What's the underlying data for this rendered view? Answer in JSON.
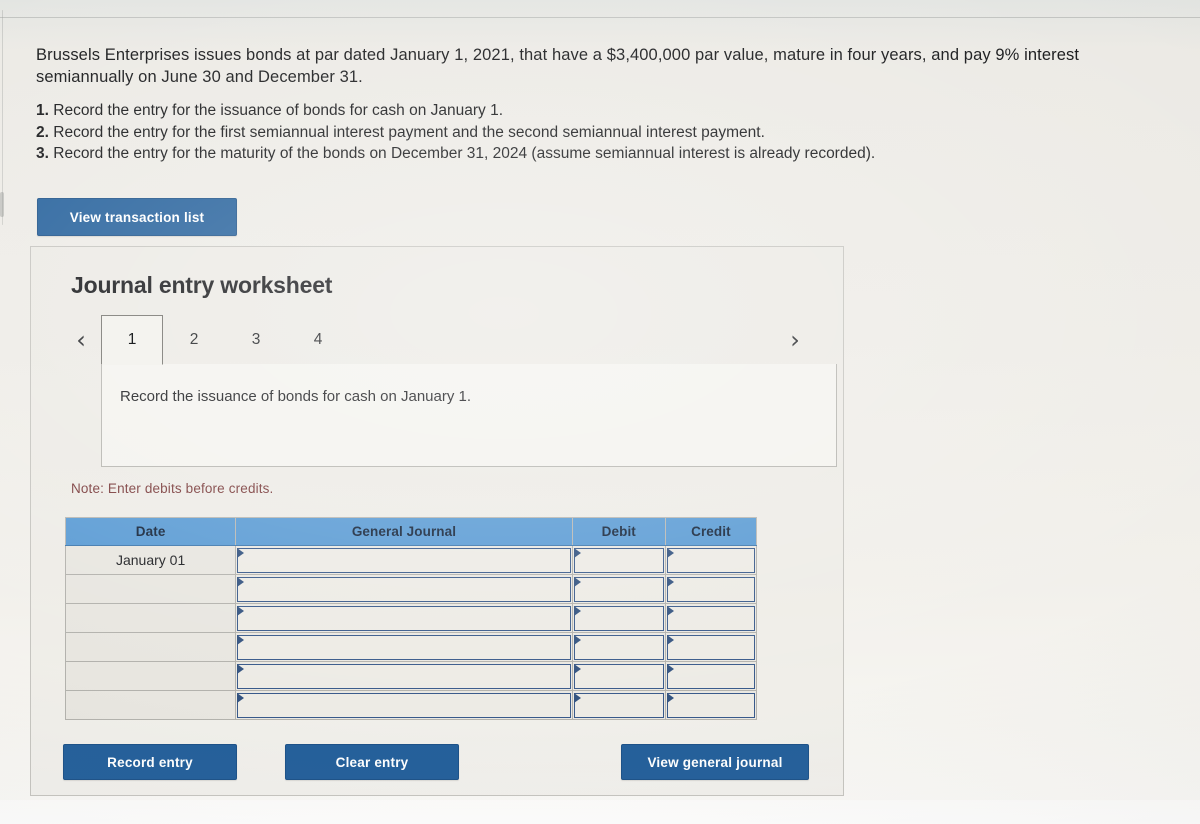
{
  "problem": {
    "statement": "Brussels Enterprises issues bonds at par dated January 1, 2021, that have a $3,400,000 par value, mature in four years, and pay 9% interest semiannually on June 30 and December 31.",
    "requirements": [
      {
        "num": "1.",
        "text": "Record the entry for the issuance of bonds for cash on January 1."
      },
      {
        "num": "2.",
        "text": "Record the entry for the first semiannual interest payment and the second semiannual interest payment."
      },
      {
        "num": "3.",
        "text": "Record the entry for the maturity of the bonds on December 31, 2024 (assume semiannual interest is already recorded)."
      }
    ]
  },
  "toolbar": {
    "view_transaction_list_label": "View transaction list"
  },
  "worksheet": {
    "title": "Journal entry worksheet",
    "prev_icon": "chevron-left-icon",
    "next_icon": "chevron-right-icon",
    "tabs": [
      {
        "label": "1",
        "active": true
      },
      {
        "label": "2",
        "active": false
      },
      {
        "label": "3",
        "active": false
      },
      {
        "label": "4",
        "active": false
      }
    ],
    "prompt": "Record the issuance of bonds for cash on January 1.",
    "note": "Note: Enter debits before credits.",
    "table": {
      "columns": [
        "Date",
        "General Journal",
        "Debit",
        "Credit"
      ],
      "rows": [
        {
          "date": "January 01",
          "general_journal": "",
          "debit": "",
          "credit": ""
        },
        {
          "date": "",
          "general_journal": "",
          "debit": "",
          "credit": ""
        },
        {
          "date": "",
          "general_journal": "",
          "debit": "",
          "credit": ""
        },
        {
          "date": "",
          "general_journal": "",
          "debit": "",
          "credit": ""
        },
        {
          "date": "",
          "general_journal": "",
          "debit": "",
          "credit": ""
        },
        {
          "date": "",
          "general_journal": "",
          "debit": "",
          "credit": ""
        }
      ]
    },
    "buttons": {
      "record_entry_label": "Record entry",
      "clear_entry_label": "Clear entry",
      "view_general_journal_label": "View general journal"
    }
  },
  "colors": {
    "button_blue": "#24609b",
    "table_header_blue": "#5a9bd4",
    "input_border_blue": "#38598a",
    "note_text": "#7a3b3b",
    "page_background": "#eeece7"
  }
}
